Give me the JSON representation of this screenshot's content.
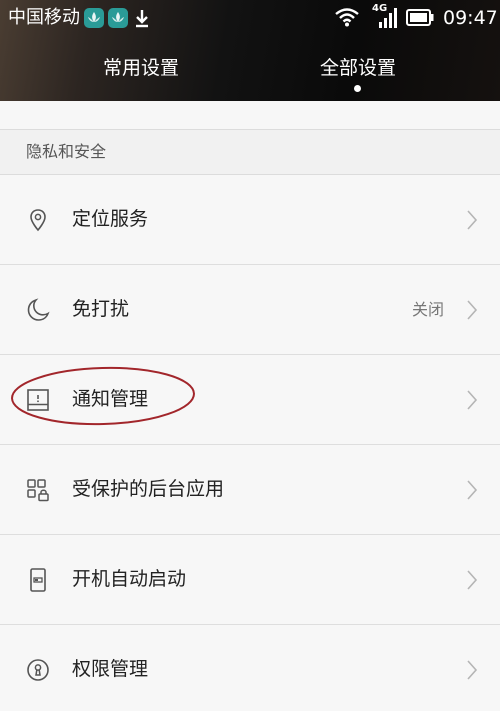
{
  "status_bar": {
    "carrier": "中国移动",
    "network_type": "4G",
    "time": "09:47",
    "icons": [
      "huawei-app-icon",
      "huawei-app-icon",
      "download-icon",
      "wifi-icon",
      "signal-icon",
      "battery-icon"
    ]
  },
  "tabs": [
    {
      "label": "常用设置",
      "active": false
    },
    {
      "label": "全部设置",
      "active": true
    }
  ],
  "section": {
    "title": "隐私和安全"
  },
  "items": [
    {
      "label": "定位服务",
      "value": "",
      "icon": "location-pin-icon"
    },
    {
      "label": "免打扰",
      "value": "关闭",
      "icon": "moon-icon"
    },
    {
      "label": "通知管理",
      "value": "",
      "icon": "notification-panel-icon"
    },
    {
      "label": "受保护的后台应用",
      "value": "",
      "icon": "protected-apps-icon"
    },
    {
      "label": "开机自动启动",
      "value": "",
      "icon": "startup-icon"
    },
    {
      "label": "权限管理",
      "value": "",
      "icon": "permission-keyhole-icon"
    }
  ],
  "colors": {
    "header_background": "#121212",
    "annotation_ellipse": "#a2262b",
    "page_background": "#f7f7f7"
  }
}
